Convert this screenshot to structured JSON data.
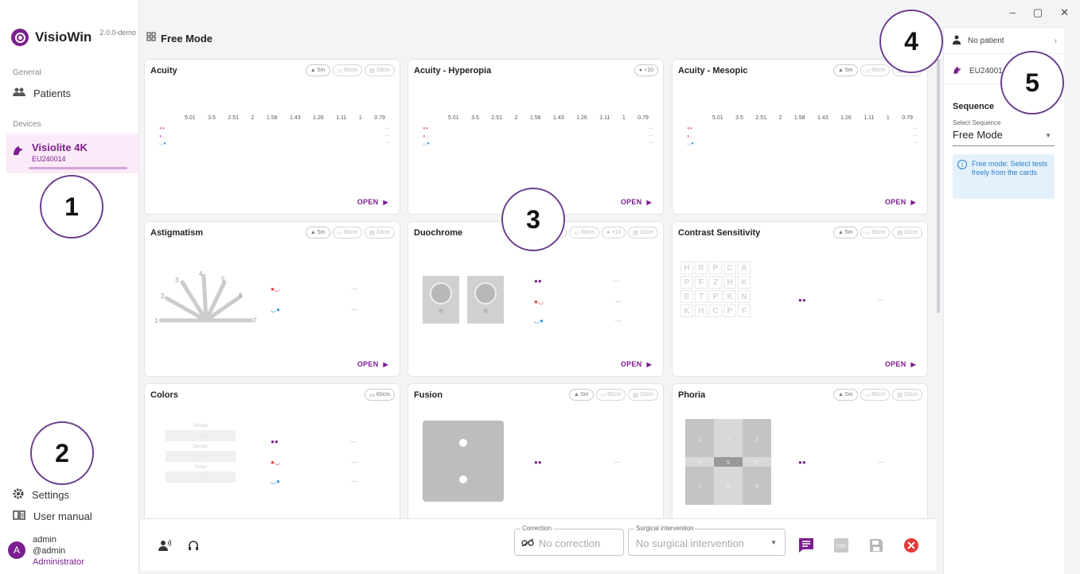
{
  "window": {
    "minimize": "–",
    "restore": "▢",
    "close": "✕"
  },
  "app": {
    "name": "VisioWin",
    "version": "2.0.0-demo"
  },
  "sidebar": {
    "general_label": "General",
    "patients_label": "Patients",
    "devices_label": "Devices",
    "device": {
      "name": "Visiolite 4K",
      "code": "EU240014"
    },
    "settings_label": "Settings",
    "manual_label": "User manual",
    "user": {
      "initial": "A",
      "name": "admin",
      "handle": "@admin",
      "role": "Administrator"
    }
  },
  "header": {
    "title": "Free Mode"
  },
  "acuity_scale": [
    "5.01",
    "3.5",
    "2.51",
    "2",
    "1.58",
    "1.43",
    "1.26",
    "1.11",
    "1",
    "0.79"
  ],
  "cards": {
    "acuity": {
      "title": "Acuity",
      "pills": [
        "5m",
        "60cm",
        "33cm"
      ],
      "open": "OPEN"
    },
    "hyperopia": {
      "title": "Acuity - Hyperopia",
      "pills": [
        "+10"
      ],
      "open": "OPEN"
    },
    "mesopic": {
      "title": "Acuity - Mesopic",
      "pills": [
        "5m",
        "60cm",
        "33cm"
      ],
      "open": "OPEN"
    },
    "astigmatism": {
      "title": "Astigmatism",
      "pills": [
        "5m",
        "60cm",
        "33cm"
      ],
      "open": "OPEN",
      "rays": [
        "1",
        "2",
        "3",
        "4",
        "5",
        "6",
        "7"
      ]
    },
    "duochrome": {
      "title": "Duochrome",
      "pills": [
        "5m",
        "60cm",
        "+10",
        "33cm"
      ],
      "open": "OPEN"
    },
    "contrast": {
      "title": "Contrast Sensitivity",
      "pills": [
        "5m",
        "60cm",
        "33cm"
      ],
      "open": "OPEN",
      "letters": [
        "H",
        "R",
        "P",
        "C",
        "A",
        "P",
        "F",
        "Z",
        "H",
        "K",
        "E",
        "T",
        "P",
        "K",
        "N",
        "K",
        "H",
        "C",
        "P",
        "F"
      ]
    },
    "colors": {
      "title": "Colors",
      "pills": [
        "60cm"
      ],
      "rows": [
        "Protan",
        "Deutan",
        "Tritan"
      ],
      "cells": [
        "– – –",
        "– – –",
        "– – –"
      ]
    },
    "fusion": {
      "title": "Fusion",
      "pills": [
        "5m",
        "60cm",
        "33cm"
      ]
    },
    "phoria": {
      "title": "Phoria",
      "pills": [
        "5m",
        "60cm",
        "33cm"
      ],
      "grid": [
        "1",
        "2",
        "3",
        "4",
        "5",
        "6",
        "7",
        "8",
        "9"
      ]
    }
  },
  "dash": "—",
  "right_panel": {
    "patient": "No patient",
    "device_code": "EU240014",
    "sequence_title": "Sequence",
    "select_label": "Select Sequence",
    "select_value": "Free Mode",
    "info": "Free mode: Select tests freely from the cards"
  },
  "toolbar": {
    "correction_label": "Correction",
    "correction_value": "No correction",
    "surgery_label": "Surgical intervention",
    "surgery_value": "No surgical intervention"
  },
  "bubbles": [
    "1",
    "2",
    "3",
    "4",
    "5"
  ],
  "colors": {
    "accent": "#7b1f8e",
    "danger": "#e53935",
    "info": "#2b7fc7"
  }
}
